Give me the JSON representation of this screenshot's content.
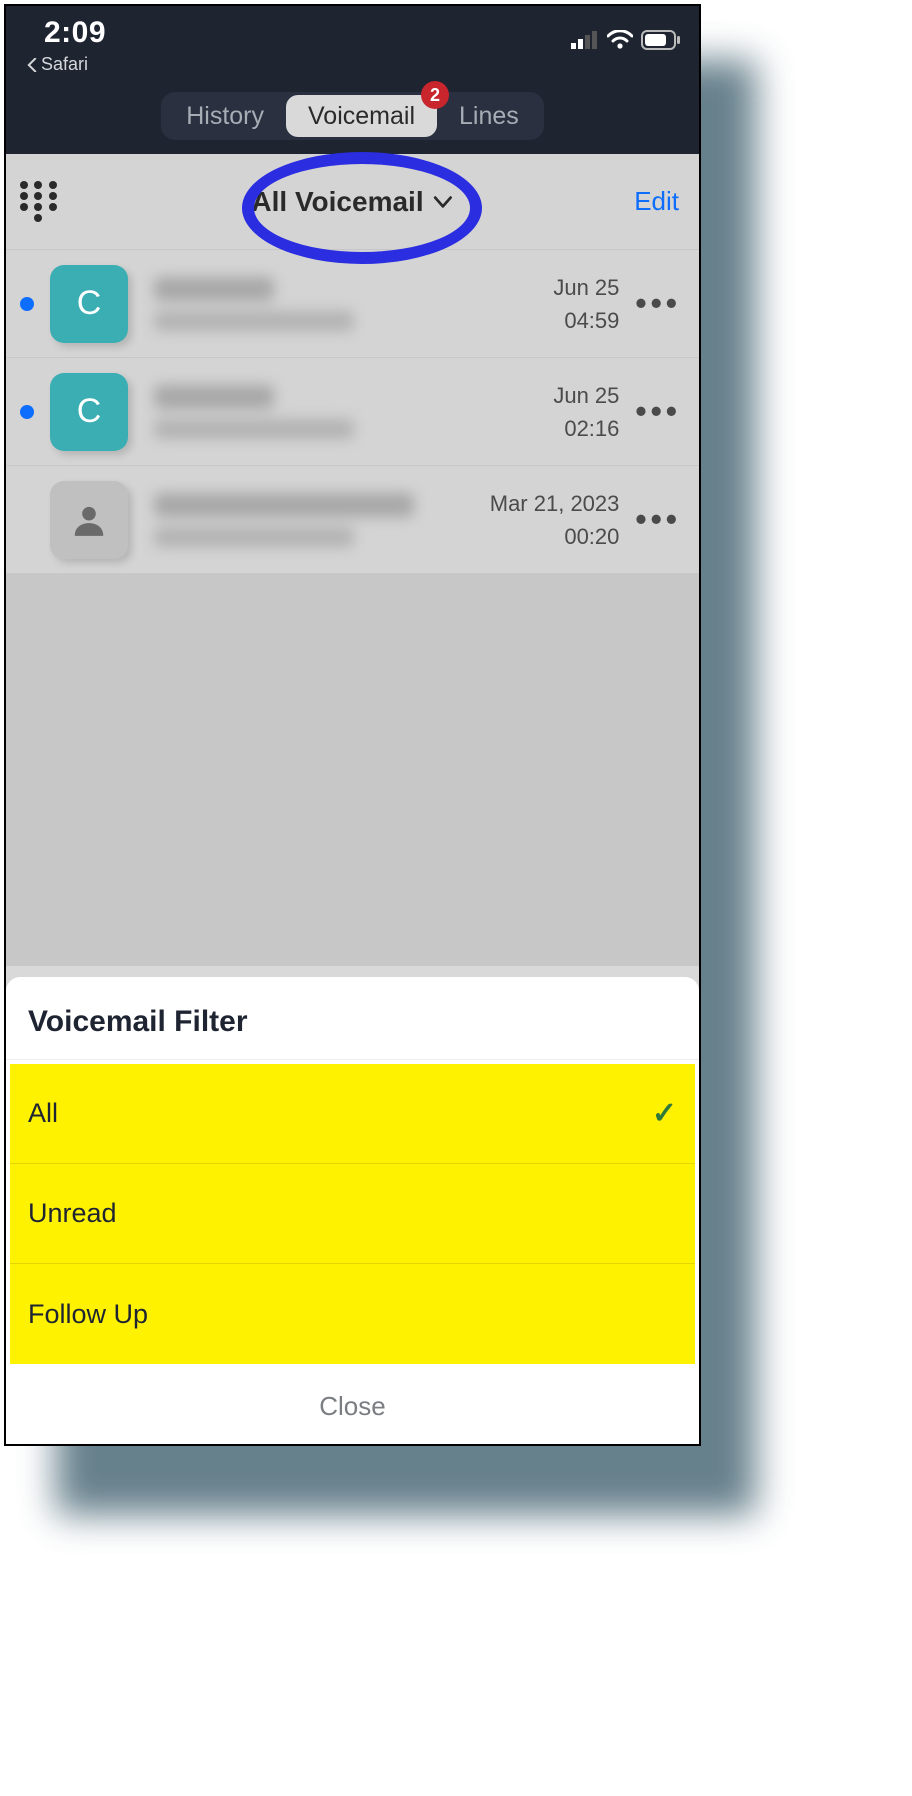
{
  "statusbar": {
    "time": "2:09",
    "back_app": "Safari"
  },
  "tabs": {
    "history": "History",
    "voicemail": "Voicemail",
    "lines": "Lines",
    "badge": "2"
  },
  "header": {
    "title": "All Voicemail",
    "edit": "Edit"
  },
  "rows": [
    {
      "avatar_letter": "C",
      "avatar_type": "teal",
      "unread": true,
      "date": "Jun 25",
      "time": "04:59"
    },
    {
      "avatar_letter": "C",
      "avatar_type": "teal",
      "unread": true,
      "date": "Jun 25",
      "time": "02:16"
    },
    {
      "avatar_letter": "",
      "avatar_type": "grey",
      "unread": false,
      "date": "Mar 21, 2023",
      "time": "00:20"
    }
  ],
  "sheet": {
    "title": "Voicemail Filter",
    "options": [
      {
        "label": "All",
        "selected": true
      },
      {
        "label": "Unread",
        "selected": false
      },
      {
        "label": "Follow Up",
        "selected": false
      }
    ],
    "close": "Close"
  }
}
